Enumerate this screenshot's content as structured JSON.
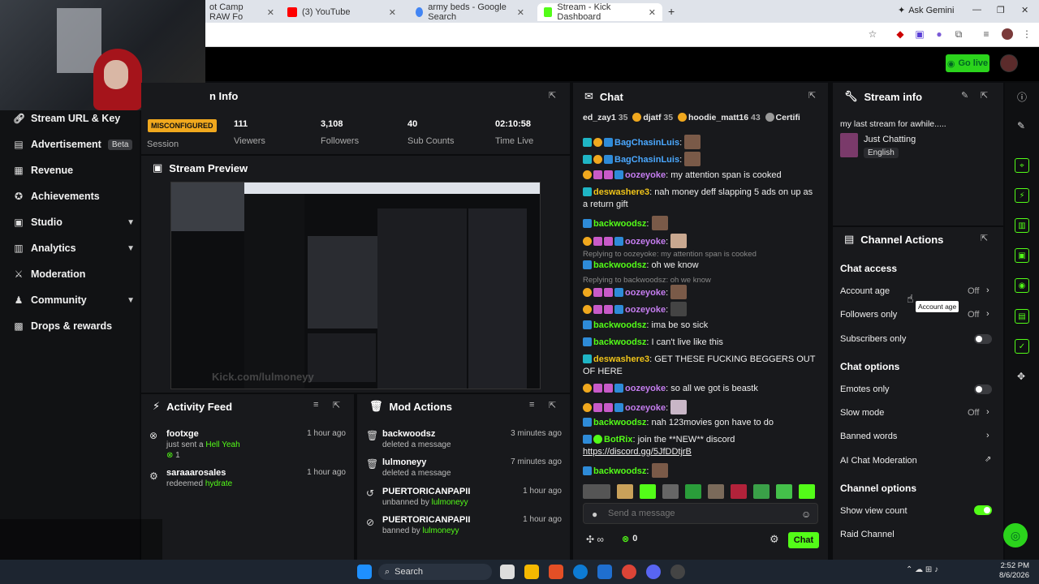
{
  "browser": {
    "tabs": [
      {
        "label": "ot Camp RAW Fo",
        "favicon_color": "#d33"
      },
      {
        "label": "(3) YouTube",
        "favicon_color": "#f00"
      },
      {
        "label": "army beds - Google Search",
        "favicon_color": "#4285f4"
      },
      {
        "label": "Stream - Kick Dashboard",
        "favicon_color": "#53fc18"
      }
    ],
    "ask_gemini": "Ask Gemini"
  },
  "topbar": {
    "go_live": "Go live"
  },
  "sidebar": {
    "items": [
      {
        "label": "Stream URL & Key",
        "icon": "link-icon"
      },
      {
        "label": "Advertisement",
        "badge": "Beta",
        "icon": "ad-icon"
      },
      {
        "label": "Revenue",
        "icon": "revenue-icon"
      },
      {
        "label": "Achievements",
        "icon": "trophy-icon"
      },
      {
        "label": "Studio",
        "icon": "studio-icon",
        "expandable": true
      },
      {
        "label": "Analytics",
        "icon": "analytics-icon",
        "expandable": true
      },
      {
        "label": "Moderation",
        "icon": "sword-icon"
      },
      {
        "label": "Community",
        "icon": "community-icon",
        "expandable": true
      },
      {
        "label": "Drops & rewards",
        "icon": "gift-icon"
      }
    ]
  },
  "session": {
    "title": "n Info",
    "status": "MISCONFIGURED",
    "session_label": "Session",
    "stats": [
      {
        "value": "111",
        "label": "Viewers"
      },
      {
        "value": "3,108",
        "label": "Followers"
      },
      {
        "value": "40",
        "label": "Sub Counts"
      },
      {
        "value": "02:10:58",
        "label": "Time Live"
      }
    ]
  },
  "preview": {
    "title": "Stream Preview",
    "overlay_text": "Kick.com/lulmoneyy"
  },
  "activity": {
    "title": "Activity Feed",
    "items": [
      {
        "user": "footxge",
        "action": "just sent a",
        "gift": "Hell Yeah",
        "count": "1",
        "time": "1 hour ago"
      },
      {
        "user": "saraaarosales",
        "action": "redeemed",
        "gift": "hydrate",
        "time": "1 hour ago"
      }
    ]
  },
  "mod": {
    "title": "Mod Actions",
    "items": [
      {
        "user": "backwoodsz",
        "action": "deleted a message",
        "by": "",
        "time": "3 minutes ago"
      },
      {
        "user": "lulmoneyy",
        "action": "deleted a message",
        "by": "",
        "time": "7 minutes ago"
      },
      {
        "user": "PUERTORICANPAPII",
        "action": "unbanned by",
        "by": "lulmoneyy",
        "time": "1 hour ago"
      },
      {
        "user": "PUERTORICANPAPII",
        "action": "banned by",
        "by": "lulmoneyy",
        "time": "1 hour ago"
      }
    ]
  },
  "chat": {
    "title": "Chat",
    "top_gifters": [
      {
        "name": "ed_zay1",
        "count": "35"
      },
      {
        "name": "djatf",
        "count": "35"
      },
      {
        "name": "hoodie_matt16",
        "count": "43"
      },
      {
        "name": "Certifi",
        "count": ""
      }
    ],
    "messages": [
      {
        "user": "BagChasinLuis",
        "text": ":",
        "color": "#4aa8ff"
      },
      {
        "user": "BagChasinLuis",
        "text": ":",
        "color": "#4aa8ff"
      },
      {
        "user": "oozeyoke",
        "text": ": my attention span is cooked",
        "color": "#c57df0"
      },
      {
        "user": "deswashere3",
        "text": ": nah money deff slapping 5 ads on up as a return gift",
        "color": "#f0c419"
      },
      {
        "user": "backwoodsz",
        "text": ":",
        "color": "#53fc18"
      },
      {
        "user": "oozeyoke",
        "text": ":",
        "color": "#c57df0"
      },
      {
        "reply": "Replying to oozeyoke: my attention span is cooked"
      },
      {
        "user": "backwoodsz",
        "text": ": oh we know",
        "color": "#53fc18"
      },
      {
        "reply": "Replying to backwoodsz: oh we know"
      },
      {
        "user": "oozeyoke",
        "text": ":",
        "color": "#c57df0"
      },
      {
        "user": "oozeyoke",
        "text": ":",
        "color": "#c57df0"
      },
      {
        "user": "backwoodsz",
        "text": ": ima be so sick",
        "color": "#53fc18"
      },
      {
        "user": "backwoodsz",
        "text": ": I can't live like this",
        "color": "#53fc18"
      },
      {
        "user": "deswashere3",
        "text": ": GET THESE FUCKING BEGGERS OUT OF HERE",
        "color": "#f0c419"
      },
      {
        "user": "oozeyoke",
        "text": ": so all we got is beastk",
        "color": "#c57df0"
      },
      {
        "user": "oozeyoke",
        "text": ":",
        "color": "#c57df0"
      },
      {
        "user": "backwoodsz",
        "text": ": nah 123movies gon have to do",
        "color": "#53fc18"
      },
      {
        "user": "BotRix",
        "text": ": join the **NEW** discord",
        "link": "https://discord.gg/5JfDDtjrB",
        "color": "#53fc18"
      },
      {
        "user": "backwoodsz",
        "text": ":",
        "color": "#53fc18"
      }
    ],
    "input_placeholder": "Send a message",
    "points": "0",
    "chat_button": "Chat"
  },
  "stream_info": {
    "title": "Stream info",
    "stream_title": "my last stream for awhile.....",
    "category": "Just Chatting",
    "language": "English"
  },
  "channel_actions": {
    "title": "Channel Actions",
    "chat_access_heading": "Chat access",
    "account_age": "Account age",
    "account_age_value": "Off",
    "tooltip": "Account age",
    "followers_only": "Followers only",
    "followers_only_value": "Off",
    "subscribers_only": "Subscribers only",
    "chat_options_heading": "Chat options",
    "emotes_only": "Emotes only",
    "slow_mode": "Slow mode",
    "slow_mode_value": "Off",
    "banned_words": "Banned words",
    "ai_moderation": "AI Chat Moderation",
    "channel_options_heading": "Channel options",
    "show_view_count": "Show view count",
    "raid_channel": "Raid Channel"
  },
  "taskbar": {
    "search": "Search",
    "time": "2:52 PM",
    "date": "8/6/2026"
  }
}
